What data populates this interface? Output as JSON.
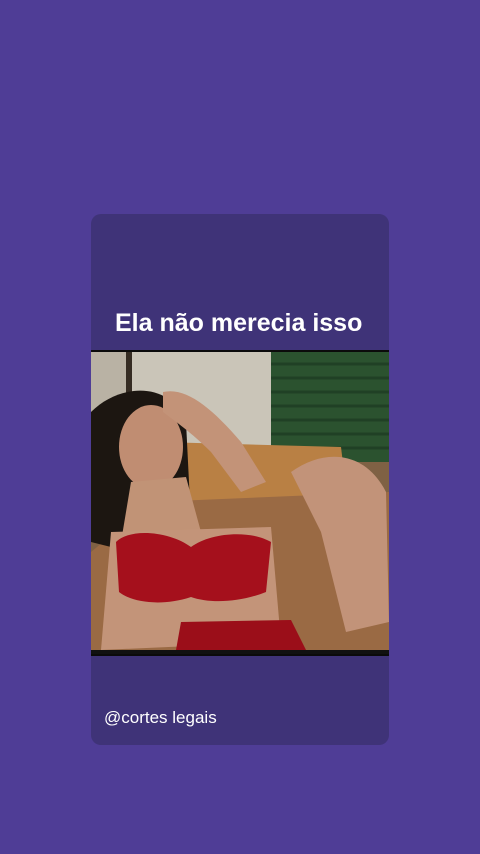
{
  "post": {
    "caption": "Ela não merecia isso",
    "handle": "@cortes legais",
    "video_frame_icon": "video-frame-image"
  },
  "colors": {
    "background": "#4f3d96",
    "card": "#3f3378",
    "text": "#ffffff"
  }
}
